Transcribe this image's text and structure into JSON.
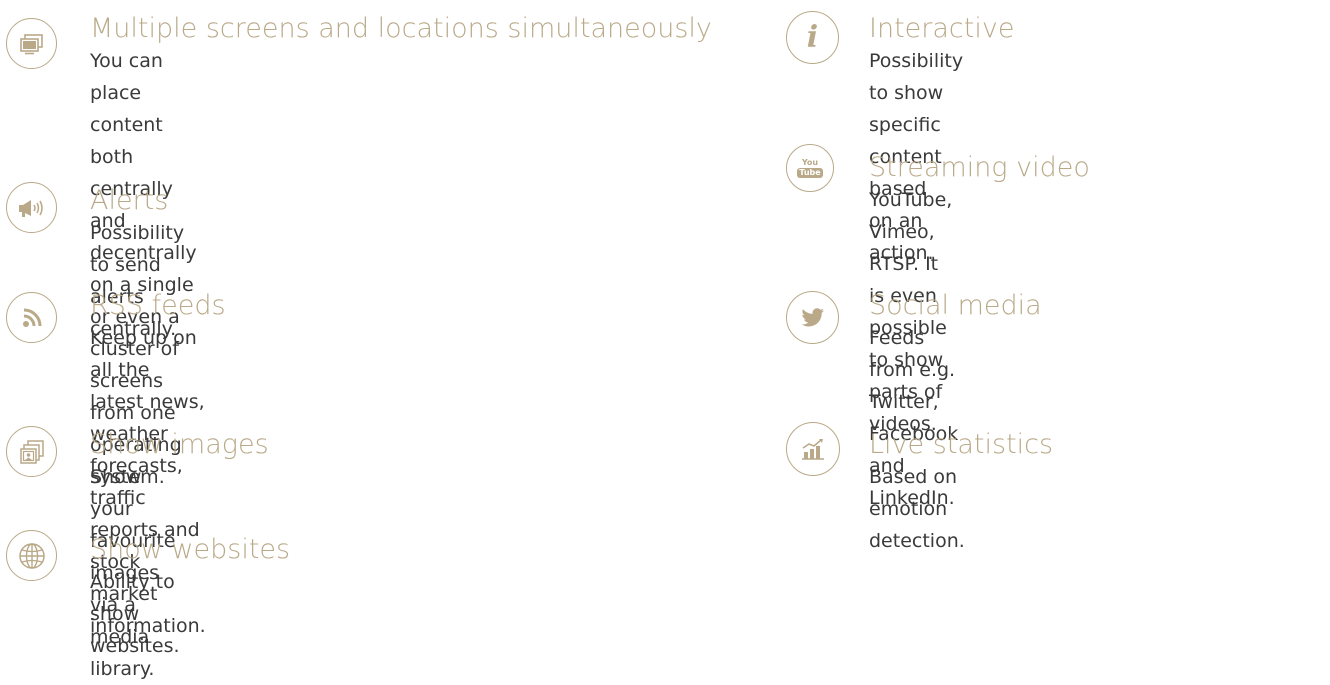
{
  "colors": {
    "accent": "#b9a988",
    "body_text": "#3a3a3a",
    "background": "#ffffff"
  },
  "left_features": [
    {
      "icon": "monitor-icon",
      "title": "Multiple screens and locations simultaneously",
      "lines": [
        "You can place content both centrally and decentrally",
        "on a single or even a cluster of screens from one",
        "operating system."
      ]
    },
    {
      "icon": "megaphone-icon",
      "title": "Alerts",
      "lines": [
        "Possibility to send alerts centrally."
      ]
    },
    {
      "icon": "rss-icon",
      "title": "RSS feeds",
      "lines": [
        "Keep up on all the latest news, weather forecasts,",
        "traffic reports and stock market information."
      ]
    },
    {
      "icon": "images-icon",
      "title": "Show images",
      "lines": [
        "Show your favourite images via a media library."
      ]
    },
    {
      "icon": "globe-icon",
      "title": "Show websites",
      "lines": [
        "Ability to show websites."
      ]
    }
  ],
  "right_features": [
    {
      "icon": "info-icon",
      "icon_text": "i",
      "title": "Interactive",
      "lines": [
        "Possibility to show specific content based",
        "on an action."
      ]
    },
    {
      "icon": "youtube-icon",
      "icon_text_top": "You",
      "icon_text_bottom": "Tube",
      "title": "Streaming video",
      "lines": [
        "YouTube, Vimeo, RTSP. It is even possible",
        "to show parts of videos."
      ]
    },
    {
      "icon": "twitter-bird-icon",
      "title": "Social media",
      "lines": [
        "Feeds from e.g. Twitter, Facebook",
        "and LinkedIn."
      ]
    },
    {
      "icon": "bar-chart-icon",
      "title": "Live statistics",
      "lines": [
        "Based on emotion detection."
      ]
    }
  ]
}
